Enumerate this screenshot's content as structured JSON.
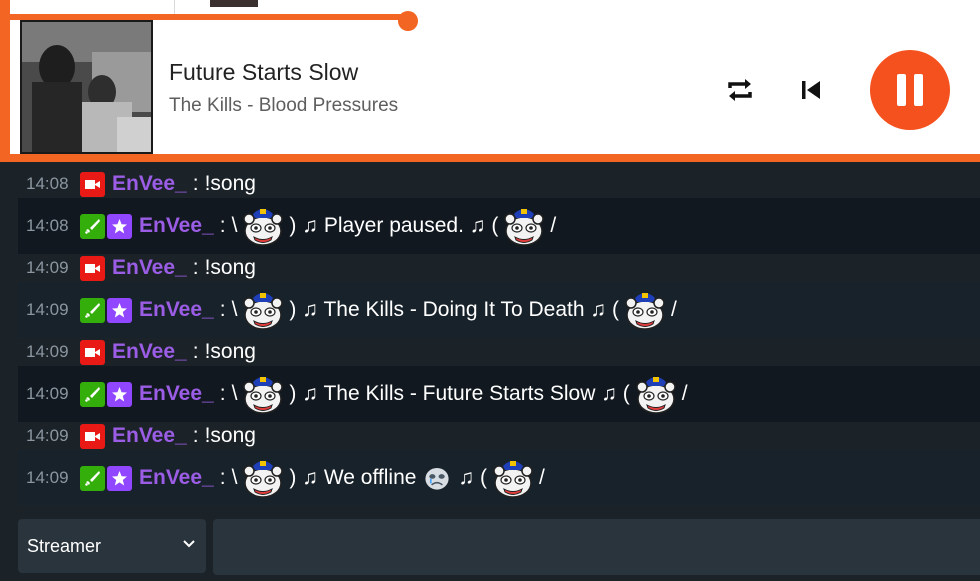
{
  "player": {
    "title": "Future Starts Slow",
    "subtitle": "The Kills - Blood Pressures",
    "progress_percent": 41,
    "accent_color": "#f26522",
    "controls": {
      "repeat": "repeat-icon",
      "previous": "skip-previous-icon",
      "pause": "pause-icon"
    }
  },
  "chat": {
    "messages": [
      {
        "time": "14:08",
        "badges": [
          "broadcaster"
        ],
        "user": "EnVee_",
        "text": "!song"
      },
      {
        "time": "14:08",
        "badges": [
          "moderator",
          "subscriber"
        ],
        "user": "EnVee_",
        "parts": [
          "\\",
          "emote",
          ") ♫ Player paused. ♫ (",
          "emote",
          "/"
        ]
      },
      {
        "time": "14:09",
        "badges": [
          "broadcaster"
        ],
        "user": "EnVee_",
        "text": "!song"
      },
      {
        "time": "14:09",
        "badges": [
          "moderator",
          "subscriber"
        ],
        "user": "EnVee_",
        "parts": [
          "\\",
          "emote",
          ") ♫ The Kills - Doing It To Death ♫ (",
          "emote",
          "/"
        ]
      },
      {
        "time": "14:09",
        "badges": [
          "broadcaster"
        ],
        "user": "EnVee_",
        "text": "!song"
      },
      {
        "time": "14:09",
        "badges": [
          "moderator",
          "subscriber"
        ],
        "user": "EnVee_",
        "parts": [
          "\\",
          "emote",
          ") ♫ The Kills - Future Starts Slow ♫ (",
          "emote",
          "/"
        ]
      },
      {
        "time": "14:09",
        "badges": [
          "broadcaster"
        ],
        "user": "EnVee_",
        "text": "!song"
      },
      {
        "time": "14:09",
        "badges": [
          "moderator",
          "subscriber"
        ],
        "user": "EnVee_",
        "parts": [
          "\\",
          "emote",
          ") ♫ We offline",
          "sad-emote",
          "♫ (",
          "emote",
          "/"
        ]
      }
    ],
    "colon": ":",
    "username_color": "#9b5de5"
  },
  "input": {
    "role_select": "Streamer",
    "message_value": ""
  }
}
